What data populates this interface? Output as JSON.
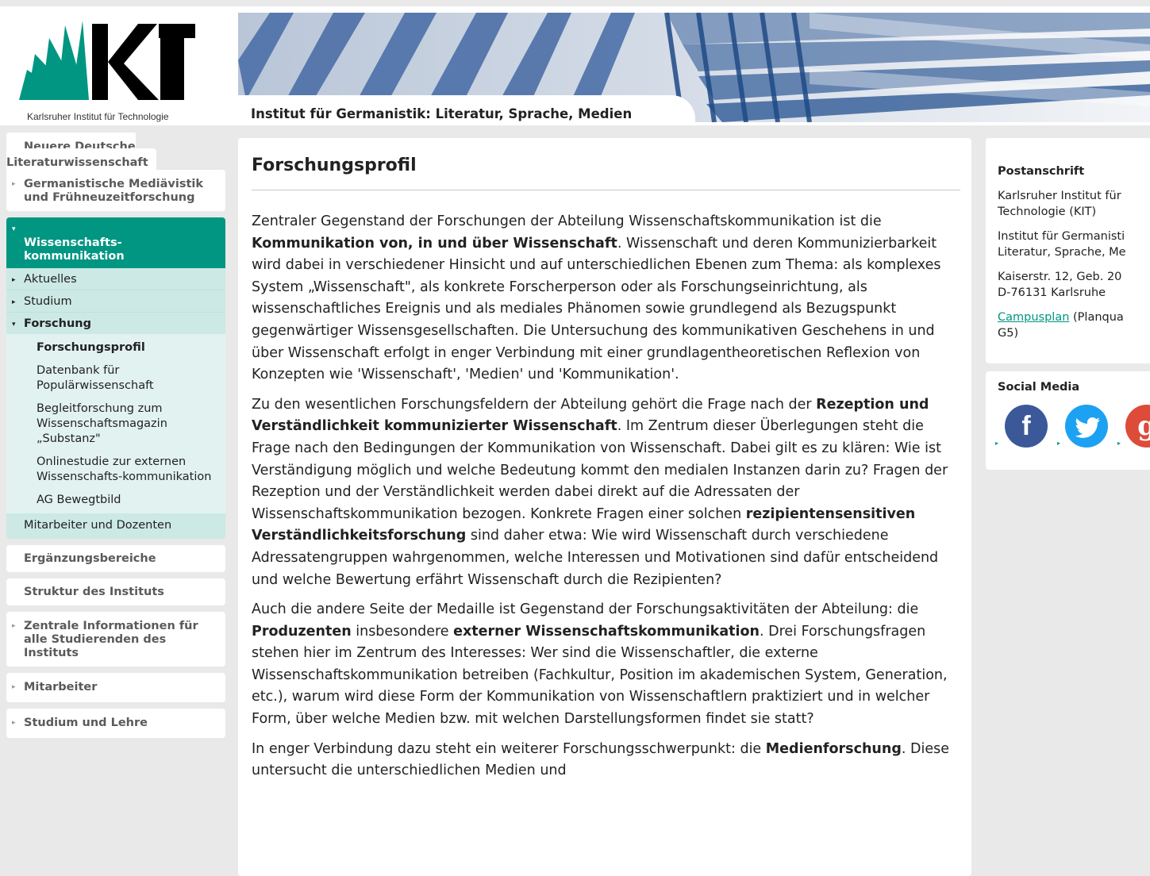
{
  "header": {
    "logo_subtitle": "Karlsruher Institut für Technologie",
    "institute_title": "Institut für Germanistik: Literatur, Sprache, Medien"
  },
  "nav": {
    "top_items": [
      "Neuere Deutsche Literaturwissenschaft",
      "Germanistische Mediävistik und Frühneuzeitforschung"
    ],
    "active_section": "Wissenschafts-\nkommunikation",
    "active_sub": [
      "Aktuelles",
      "Studium",
      "Forschung"
    ],
    "forschung_items": [
      "Forschungsprofil",
      "Datenbank für Populärwissenschaft",
      "Begleitforschung zum Wissenschaftsmagazin „Substanz\"",
      "Onlinestudie zur externen Wissenschafts-kommunikation",
      "AG Bewegtbild"
    ],
    "active_last": "Mitarbeiter und Dozenten",
    "bottom_items": [
      "Ergänzungsbereiche",
      "Struktur des Instituts",
      "Zentrale Informationen für alle Studierenden des Instituts",
      "Mitarbeiter",
      "Studium und Lehre"
    ]
  },
  "main": {
    "title": "Forschungsprofil",
    "p1_a": "Zentraler Gegenstand der Forschungen der Abteilung Wissenschaftskommunikation ist die ",
    "p1_b": "Kommunikation von, in und über Wissenschaft",
    "p1_c": ". Wissenschaft und deren Kommunizierbarkeit wird dabei in verschiedener Hinsicht und auf unterschiedlichen Ebenen zum Thema: als komplexes System „Wissenschaft\", als konkrete Forscherperson oder als Forschungseinrichtung, als wissenschaftliches Ereignis und als mediales Phänomen sowie grundlegend als Bezugspunkt gegenwärtiger Wissensgesellschaften. Die Untersuchung des kommunikativen Geschehens in und über Wissenschaft erfolgt in enger Verbindung mit einer grundlagentheoretischen Reflexion von Konzepten wie 'Wissenschaft', 'Medien' und 'Kommunikation'.",
    "p2_a": "Zu den wesentlichen Forschungsfeldern der Abteilung gehört die Frage nach der ",
    "p2_b": "Rezeption und Verständlichkeit kommunizierter Wissenschaft",
    "p2_c": ". Im Zentrum dieser Überlegungen steht die Frage nach den Bedingungen der Kommunikation von Wissenschaft. Dabei gilt es zu klären: Wie ist Verständigung möglich und welche Bedeutung kommt den medialen Instanzen darin zu? Fragen der Rezeption und der Verständlichkeit werden dabei direkt auf die Adressaten der Wissenschaftskommunikation bezogen. Konkrete Fragen einer solchen ",
    "p2_d": "rezipientensensitiven Verständlichkeitsforschung",
    "p2_e": " sind daher etwa: Wie wird Wissenschaft durch verschiedene Adressatengruppen wahrgenommen, welche Interessen und Motivationen sind dafür entscheidend und welche Bewertung erfährt Wissenschaft durch die Rezipienten?",
    "p3_a": "Auch die andere Seite der Medaille ist Gegenstand der Forschungsaktivitäten der Abteilung: die ",
    "p3_b": "Produzenten",
    "p3_c": " insbesondere ",
    "p3_d": "externer Wissenschaftskommunikation",
    "p3_e": ". Drei Forschungsfragen stehen hier im Zentrum des Interesses: Wer sind die Wissenschaftler, die externe Wissenschaftskommunikation betreiben (Fachkultur, Position im akademischen System, Generation, etc.), warum wird diese Form der Kommunikation von Wissenschaftlern praktiziert und in welcher Form, über welche Medien bzw. mit welchen Darstellungsformen findet sie statt?",
    "p4_a": "In enger Verbindung dazu steht ein weiterer Forschungsschwerpunkt: die ",
    "p4_b": "Medienforschung",
    "p4_c": ". Diese untersucht die unterschiedlichen Medien und"
  },
  "sidebar": {
    "postal_title": "Postanschrift",
    "line1": "Karlsruher Institut für",
    "line2": "Technologie (KIT)",
    "line3": "Institut für Germanisti",
    "line4": "Literatur, Sprache, Me",
    "line5": "Kaiserstr. 12, Geb. 20",
    "line6": "D-76131 Karlsruhe",
    "campus_link": "Campusplan",
    "campus_rest": " (Planqua",
    "line8": "G5)",
    "social_title": "Social Media",
    "facebook_glyph": "f",
    "google_glyph": "g"
  },
  "colors": {
    "kit_green": "#009682",
    "facebook": "#3b5998",
    "twitter": "#1da1f2",
    "googleplus": "#dd4b39"
  }
}
